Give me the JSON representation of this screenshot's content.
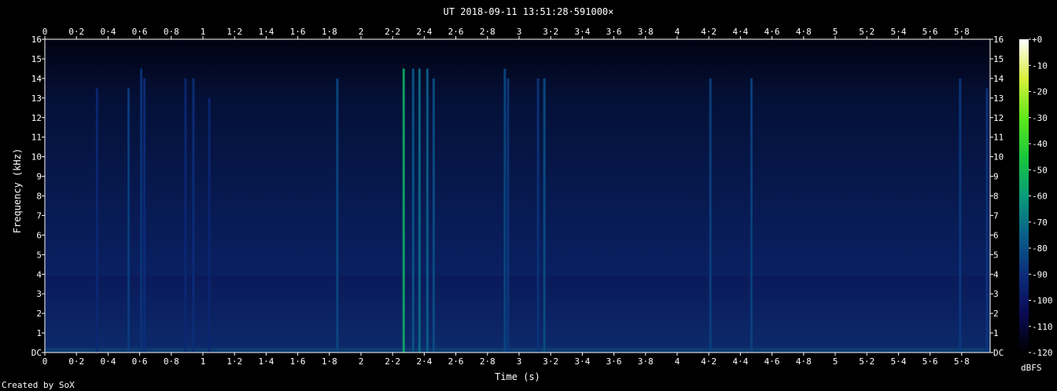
{
  "title": "UT 2018-09-11 13:51:28·591000×",
  "credit": "Created by SoX",
  "chart_data": {
    "type": "heatmap",
    "title": "UT 2018-09-11 13:51:28·591000×",
    "xlabel": "Time (s)",
    "ylabel": "Frequency (kHz)",
    "xlim": [
      0,
      5.98
    ],
    "ylim": [
      0,
      16
    ],
    "x_ticks": [
      "0",
      "0·2",
      "0·4",
      "0·6",
      "0·8",
      "1",
      "1·2",
      "1·4",
      "1·6",
      "1·8",
      "2",
      "2·2",
      "2·4",
      "2·6",
      "2·8",
      "3",
      "3·2",
      "3·4",
      "3·6",
      "3·8",
      "4",
      "4·2",
      "4·4",
      "4·6",
      "4·8",
      "5",
      "5·2",
      "5·4",
      "5·6",
      "5·8"
    ],
    "y_ticks": [
      "DC",
      "1",
      "2",
      "3",
      "4",
      "5",
      "6",
      "7",
      "8",
      "9",
      "10",
      "11",
      "12",
      "13",
      "14",
      "15",
      "16"
    ],
    "colorbar": {
      "label": "dBFS",
      "ticks": [
        "+0",
        "-10",
        "-20",
        "-30",
        "-40",
        "-50",
        "-60",
        "-70",
        "-80",
        "-90",
        "-100",
        "-110",
        "-120"
      ],
      "range": [
        -120,
        0
      ],
      "colors": [
        "#000000",
        "#0a0a55",
        "#0b2d7a",
        "#0a5f8a",
        "#0a9d7a",
        "#18c83c",
        "#5fe81a",
        "#d8f03c",
        "#ffffff"
      ]
    },
    "background": {
      "low_band_khz": [
        0,
        3.9
      ],
      "low_band_level_dbfs": -92,
      "high_band_level_dbfs": -100
    },
    "transients": [
      {
        "t": 0.33,
        "f_max": 13.5,
        "level": -92
      },
      {
        "t": 0.53,
        "f_max": 13.5,
        "level": -85
      },
      {
        "t": 0.61,
        "f_max": 14.5,
        "level": -88
      },
      {
        "t": 0.63,
        "f_max": 14.0,
        "level": -90
      },
      {
        "t": 0.89,
        "f_max": 14.0,
        "level": -92
      },
      {
        "t": 0.94,
        "f_max": 14.0,
        "level": -90
      },
      {
        "t": 1.04,
        "f_max": 13.0,
        "level": -93
      },
      {
        "t": 1.85,
        "f_max": 14.0,
        "level": -82
      },
      {
        "t": 2.27,
        "f_max": 14.5,
        "level": -55
      },
      {
        "t": 2.33,
        "f_max": 14.5,
        "level": -78
      },
      {
        "t": 2.37,
        "f_max": 14.5,
        "level": -72
      },
      {
        "t": 2.42,
        "f_max": 14.5,
        "level": -75
      },
      {
        "t": 2.46,
        "f_max": 14.0,
        "level": -80
      },
      {
        "t": 2.91,
        "f_max": 14.5,
        "level": -82
      },
      {
        "t": 2.93,
        "f_max": 14.0,
        "level": -86
      },
      {
        "t": 3.12,
        "f_max": 14.0,
        "level": -88
      },
      {
        "t": 3.16,
        "f_max": 14.0,
        "level": -80
      },
      {
        "t": 4.21,
        "f_max": 14.0,
        "level": -84
      },
      {
        "t": 4.47,
        "f_max": 14.0,
        "level": -84
      },
      {
        "t": 5.79,
        "f_max": 14.0,
        "level": -86
      },
      {
        "t": 5.96,
        "f_max": 13.5,
        "level": -88
      }
    ]
  }
}
